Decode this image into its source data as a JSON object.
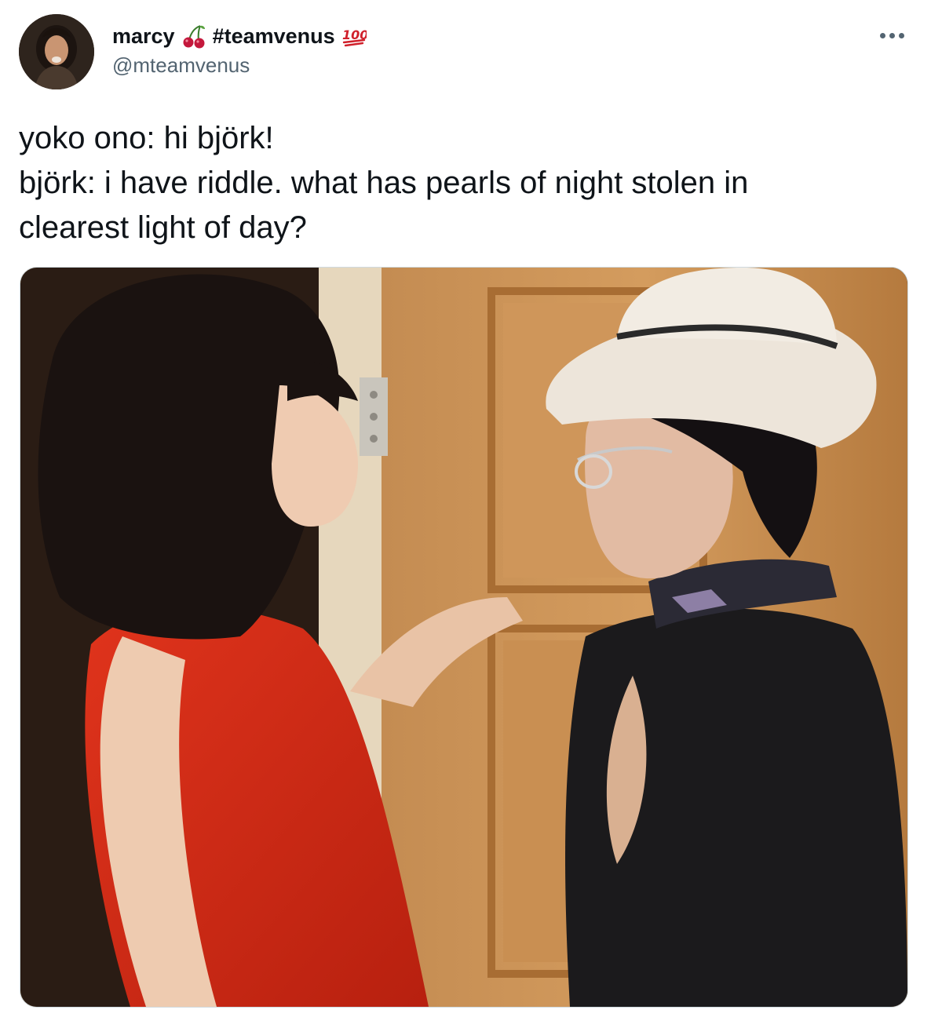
{
  "tweet": {
    "author": {
      "display_name": "marcy",
      "name_hashtag": "#teamvenus",
      "handle": "@mteamvenus",
      "avatar_icon": "profile-photo",
      "name_emojis": [
        "cherries-emoji",
        "hundred-points-emoji"
      ]
    },
    "more_icon": "more-options-icon",
    "text_lines": [
      "yoko ono: hi björk!",
      "björk: i have riddle. what has pearls of night stolen in",
      "clearest light of day?"
    ],
    "media": {
      "description_icon": "photo",
      "kind": "photo"
    }
  },
  "colors": {
    "text": "#0f1419",
    "secondary": "#536471",
    "border": "#cfd9de",
    "emoji_red": "#c4183c"
  }
}
